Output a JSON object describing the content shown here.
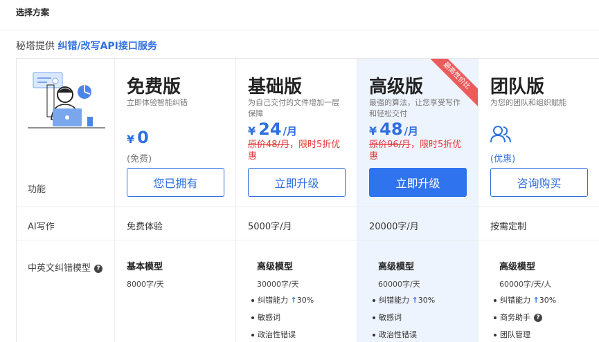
{
  "page": {
    "title": "选择方案"
  },
  "subtitle": {
    "prefix": "秘塔提供 ",
    "highlight": "纠错/改写API接口服务"
  },
  "features_label": "功能",
  "plans": [
    {
      "name": "免费版",
      "desc": "立即体验智能纠错",
      "currency": "¥",
      "price": "0",
      "price_note": "(免费)",
      "button": "您已拥有",
      "ai_writing": "免费体验",
      "model": {
        "title": "基本模型",
        "quota": "8000字/天",
        "bullets": []
      }
    },
    {
      "name": "基础版",
      "desc": "为自己交付的文件增加一层保障",
      "currency": "¥",
      "price": "24",
      "unit": "/月",
      "promo_strike": "原价48/月",
      "promo_rest": "，限时5折优惠",
      "button": "立即升级",
      "ai_writing": "5000字/月",
      "model": {
        "title": "高级模型",
        "quota": "30000字/天",
        "bullets": [
          "纠错能力",
          "敏感词",
          "政治性错误"
        ],
        "boost": "30%"
      }
    },
    {
      "name": "高级版",
      "desc": "最强的算法，让您享受写作和轻松交付",
      "currency": "¥",
      "price": "48",
      "unit": "/月",
      "promo_strike": "原价96/月",
      "promo_rest": "，限时5折优惠",
      "button": "立即升级",
      "ribbon": "最高性价比",
      "ai_writing": "20000字/月",
      "model": {
        "title": "高级模型",
        "quota": "60000字/天",
        "bullets": [
          "纠错能力",
          "敏感词",
          "政治性错误"
        ],
        "boost": "30%"
      }
    },
    {
      "name": "团队版",
      "desc": "为您的团队和组织赋能",
      "price_note": "(优惠)",
      "button": "咨询购买",
      "ai_writing": "按需定制",
      "model": {
        "title": "高级模型",
        "quota": "60000字/天/人",
        "bullets": [
          "纠错能力",
          "商务助手",
          "团队管理"
        ],
        "boost": "30%"
      }
    }
  ],
  "rows": {
    "ai_writing": "AI写作",
    "model": "中英文纠错模型"
  },
  "icons": {
    "help": "?",
    "up": "↑"
  },
  "colors": {
    "accent": "#2f73ee",
    "promo": "#e23838",
    "highlight_col": "#eef4fe",
    "ribbon": "#ec5b5b"
  }
}
